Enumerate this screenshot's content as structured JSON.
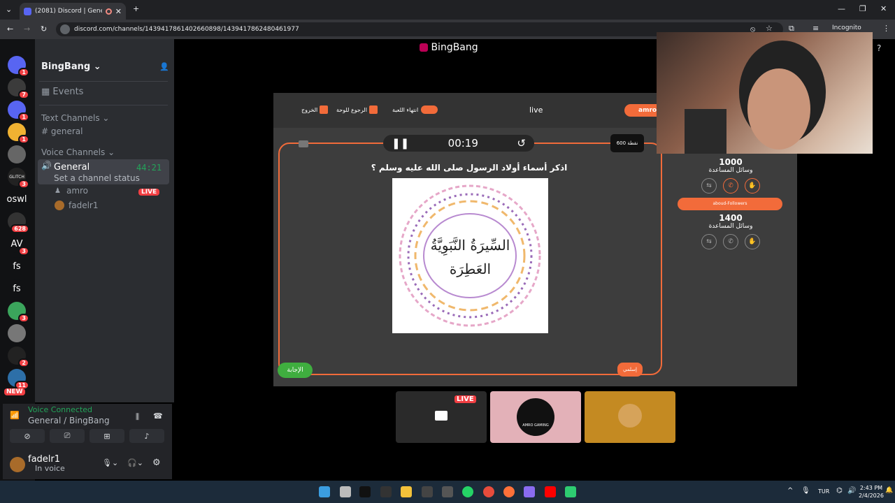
{
  "browser": {
    "tab_title": "(2081) Discord | General | B",
    "url": "discord.com/channels/1439417861402660898/1439417862480461977",
    "incognito_label": "Incognito"
  },
  "guilds": [
    {
      "label": "",
      "badge": "1",
      "color": "#5865f2"
    },
    {
      "label": "",
      "badge": "7",
      "color": "#3b3b3b"
    },
    {
      "label": "",
      "badge": "1",
      "color": "#5865f2"
    },
    {
      "label": "",
      "badge": "1",
      "color": "#f0b232"
    },
    {
      "label": "",
      "badge": "",
      "color": "#666"
    },
    {
      "label": "GLITCH",
      "badge": "3",
      "color": "#222"
    },
    {
      "label": "oswl",
      "badge": "",
      "color": "#111214"
    },
    {
      "label": "",
      "badge": "628",
      "color": "#333"
    },
    {
      "label": "AV",
      "badge": "3",
      "color": "#111214"
    },
    {
      "label": "fs",
      "badge": "",
      "color": "#111214"
    },
    {
      "label": "fs",
      "badge": "",
      "color": "#111214"
    },
    {
      "label": "",
      "badge": "3",
      "color": "#3ba55c"
    },
    {
      "label": "",
      "badge": "",
      "color": "#777"
    },
    {
      "label": "",
      "badge": "2",
      "color": "#222"
    },
    {
      "label": "",
      "badge": "11",
      "color": "#2d6fa8"
    }
  ],
  "new_badge": "NEW",
  "server": {
    "name": "BingBang",
    "events": "Events",
    "text_category": "Text Channels",
    "text_channel": "general",
    "voice_category": "Voice Channels",
    "voice_channel": "General",
    "voice_timer": "44:21",
    "channel_status": "Set a channel status",
    "voice_users": [
      {
        "name": "amro",
        "live": "LIVE"
      },
      {
        "name": "fadelr1"
      }
    ]
  },
  "voice_panel": {
    "status": "Voice Connected",
    "location": "General / BingBang"
  },
  "user_panel": {
    "name": "fadelr1",
    "status": "In voice"
  },
  "stage": {
    "title": "BingBang",
    "thumb_live": "LIVE",
    "amro_thumb_text": "AMRO GAMING"
  },
  "quiz": {
    "exit": "الخروج",
    "back": "الرجوع للوحة",
    "end": "انتهاء اللعبة",
    "live": "live",
    "player": "amro",
    "timer": "00:19",
    "points": "600 نقطة",
    "question": "اذكر أسماء أولاد الرسول صلى الله عليه وسلم ؟",
    "image_text_1": "السِّيرَةُ النَّبَوِيَّةُ",
    "image_text_2": "العَطِرَة",
    "answer_btn": "الإجابة",
    "bottom_btn": "إسلمي",
    "side": {
      "score1": "1000",
      "help1": "وسائل المساعدة",
      "team2": "aboud-Followers",
      "score2": "1400",
      "help2": "وسائل المساعدة"
    }
  },
  "taskbar": {
    "lang": "TUR",
    "time": "2:43 PM",
    "date": "2/4/2026"
  }
}
